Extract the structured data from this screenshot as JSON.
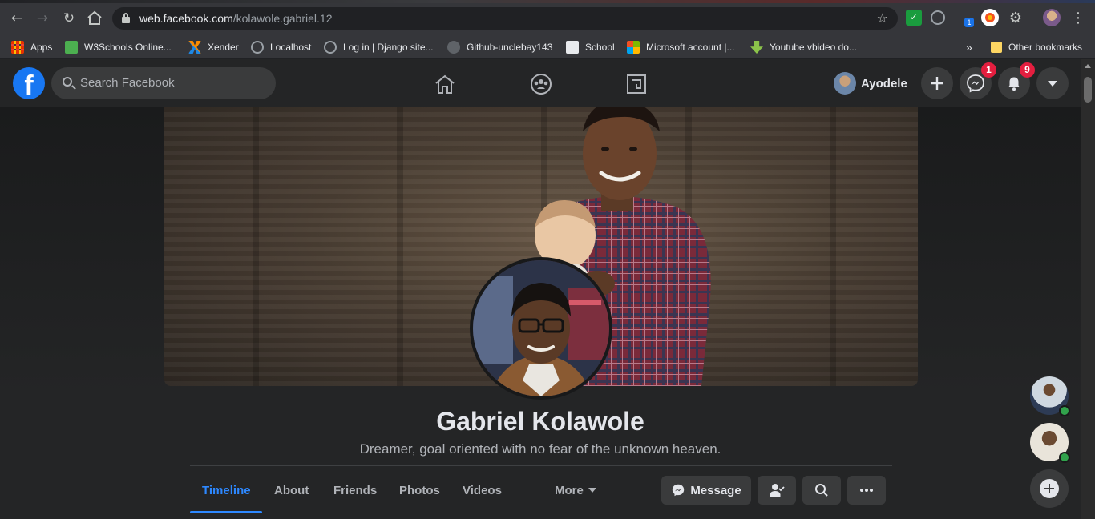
{
  "browser": {
    "url_host": "web.facebook.com",
    "url_path": "/kolawole.gabriel.12",
    "extension_badge": "1",
    "bookmarks": [
      {
        "label": "Apps",
        "icon": "apps-grid-icon",
        "color": "#ea4335"
      },
      {
        "label": "W3Schools Online...",
        "icon": "w3schools-icon",
        "color": "#4caf50"
      },
      {
        "label": "Xender",
        "icon": "xender-icon",
        "color": "#1e88e5"
      },
      {
        "label": "Localhost",
        "icon": "globe-icon",
        "color": "#9aa0a6"
      },
      {
        "label": "Log in | Django site...",
        "icon": "globe-icon",
        "color": "#9aa0a6"
      },
      {
        "label": "Github-unclebay143",
        "icon": "github-icon",
        "color": "#9aa0a6"
      },
      {
        "label": "School",
        "icon": "school-icon",
        "color": "#e8eaed"
      },
      {
        "label": "Microsoft account |...",
        "icon": "microsoft-icon",
        "color": "#f25022"
      },
      {
        "label": "Youtube vbideo do...",
        "icon": "download-icon",
        "color": "#8bc34a"
      }
    ],
    "overflow_label": "»",
    "other_bookmarks": "Other bookmarks"
  },
  "header": {
    "logo_letter": "f",
    "search_placeholder": "Search Facebook",
    "user_name": "Ayodele",
    "messenger_badge": "1",
    "notifications_badge": "9",
    "brand_color": "#1877f2",
    "badge_color": "#e41e3f"
  },
  "profile": {
    "name": "Gabriel Kolawole",
    "bio": "Dreamer, goal oriented with no fear of the unknown heaven."
  },
  "tabs": [
    {
      "label": "Timeline",
      "active": true
    },
    {
      "label": "About",
      "active": false
    },
    {
      "label": "Friends",
      "active": false
    },
    {
      "label": "Photos",
      "active": false
    },
    {
      "label": "Videos",
      "active": false
    },
    {
      "label": "More",
      "active": false
    }
  ],
  "actions": {
    "message_label": "Message"
  },
  "contacts": [
    {
      "status": "online"
    },
    {
      "status": "online"
    }
  ]
}
